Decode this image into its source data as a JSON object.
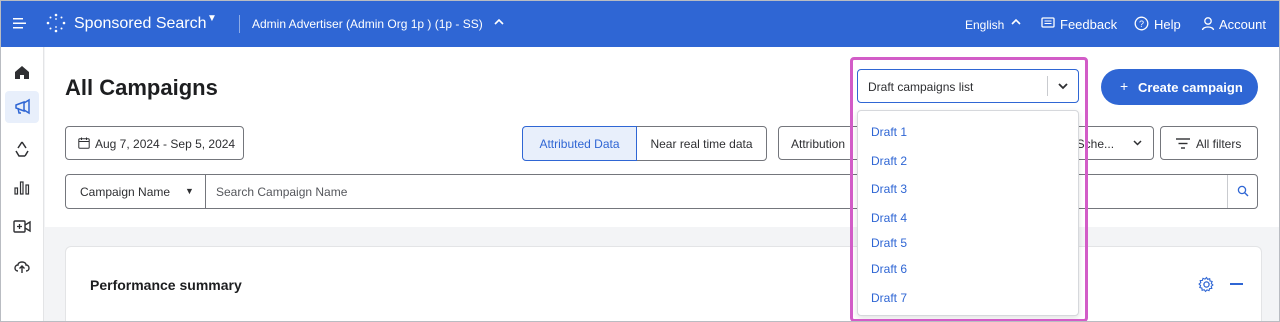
{
  "topbar": {
    "product": "Sponsored Search",
    "advertiser": "Admin Advertiser (Admin Org 1p ) (1p - SS)",
    "language": "English",
    "feedback": "Feedback",
    "help": "Help",
    "account": "Account"
  },
  "sidebar": {
    "items": [
      "home",
      "campaigns",
      "recycle",
      "analytics",
      "video",
      "upload"
    ],
    "active": "campaigns"
  },
  "page": {
    "title": "All Campaigns"
  },
  "draft_select": {
    "value": "Draft campaigns list",
    "options": [
      "Draft 1",
      "Draft 2",
      "Draft 3",
      "Draft 4",
      "Draft 5",
      "Draft 6",
      "Draft 7"
    ]
  },
  "create_button": {
    "plus": "+",
    "label": "Create campaign"
  },
  "filters": {
    "date_range": "Aug 7, 2024 - Sep 5, 2024",
    "data_toggle": [
      "Attributed Data",
      "Near real time data"
    ],
    "data_toggle_selected": "Attributed Data",
    "attribution": "Attribution",
    "schedule": ", Sche...",
    "all_filters": "All filters"
  },
  "search": {
    "field": "Campaign Name",
    "placeholder": "Search Campaign Name"
  },
  "performance": {
    "title": "Performance summary"
  },
  "colors": {
    "brand_blue": "#2f66d4",
    "highlight": "#d25cc7"
  }
}
